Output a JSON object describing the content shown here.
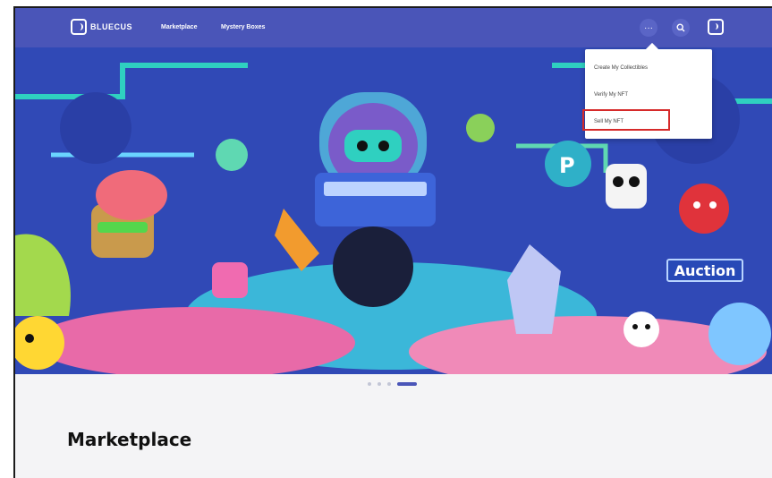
{
  "brand": {
    "logo_text": "BLUECUS"
  },
  "nav": {
    "marketplace_label": "Marketplace",
    "mystery_boxes_label": "Mystery Boxes",
    "more_icon": "ellipsis-icon",
    "search_icon": "search-icon",
    "login_icon": "login-icon"
  },
  "dropdown": {
    "items": [
      {
        "label": "Create My Collectibles"
      },
      {
        "label": "Verify My NFT"
      },
      {
        "label": "Sell My NFT"
      }
    ],
    "highlighted_item": "Sell My NFT"
  },
  "banner": {
    "badge_text": "Auction",
    "carousel": {
      "total_slides": 4,
      "active_index": 3
    }
  },
  "main": {
    "section_title": "Marketplace"
  },
  "colors": {
    "nav_bg": "#4a55b8",
    "banner_bg": "#2f46b3",
    "highlight_border": "#d62a2a",
    "page_bg": "#f4f4f6"
  }
}
